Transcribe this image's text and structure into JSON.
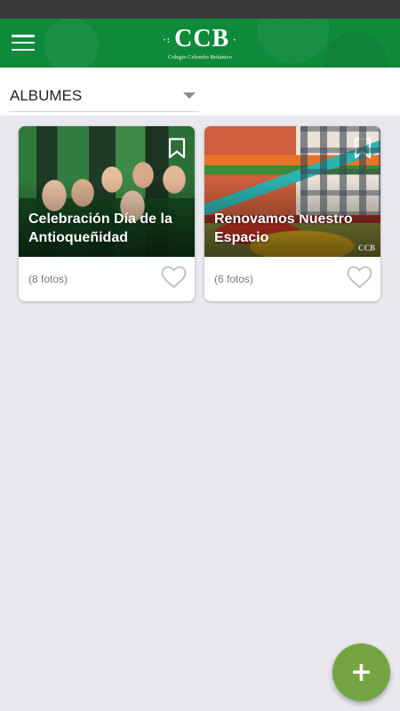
{
  "header": {
    "logo_text": "CCB",
    "logo_subtitle": "Colegio Colombo Británico",
    "menu_icon": "hamburger-menu-icon",
    "brand_color": "#0f8a3b"
  },
  "filter": {
    "selected": "ALBUMES",
    "caret_icon": "dropdown-caret-icon"
  },
  "albums": [
    {
      "title": "Celebración Día de la Antioqueñidad",
      "count": "(8 fotos)"
    },
    {
      "title": "Renovamos Nuestro Espacio",
      "count": "(6 fotos)",
      "watermark": "CCB"
    }
  ],
  "fab": {
    "label": "+",
    "color": "#75a542"
  }
}
